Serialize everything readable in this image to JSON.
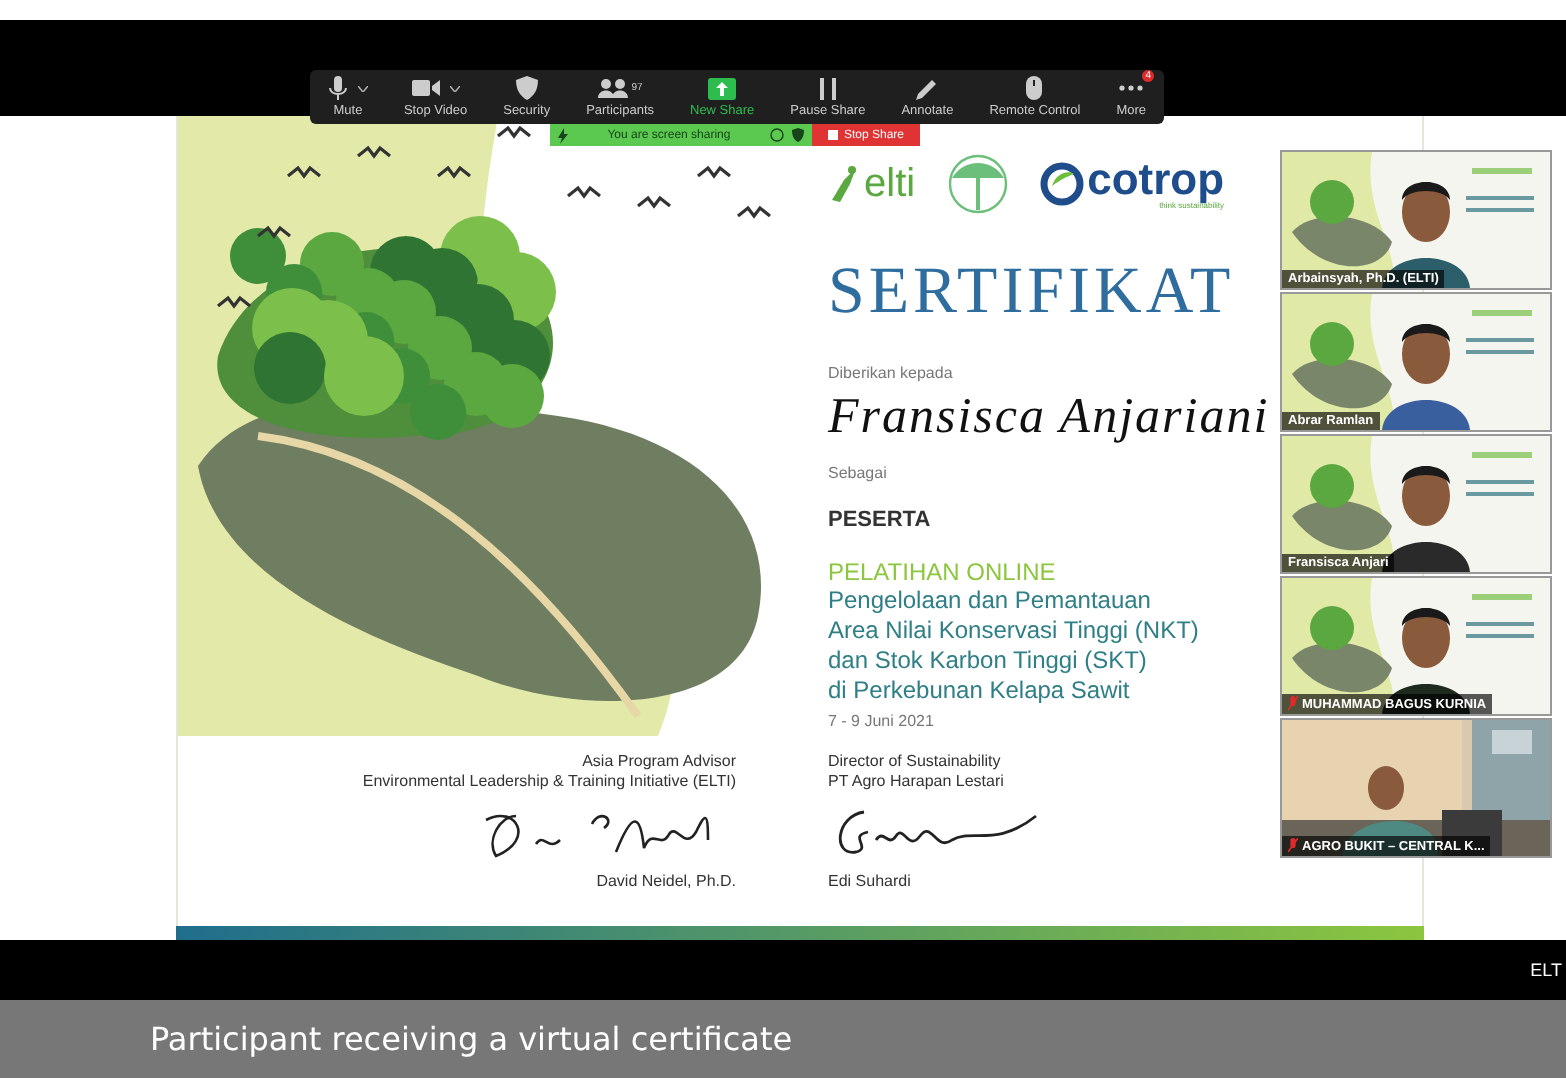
{
  "toolbar": {
    "items": [
      {
        "kind": "mic",
        "label": "Mute",
        "menu_caret": true,
        "highlighted": false
      },
      {
        "kind": "camera",
        "label": "Stop Video",
        "menu_caret": true,
        "highlighted": false
      },
      {
        "kind": "shield",
        "label": "Security",
        "menu_caret": false,
        "highlighted": false
      },
      {
        "kind": "people",
        "label": "Participants",
        "count": "97",
        "menu_caret": false,
        "highlighted": false
      },
      {
        "kind": "share",
        "label": "New Share",
        "menu_caret": false,
        "highlighted": true
      },
      {
        "kind": "pause",
        "label": "Pause Share",
        "menu_caret": false,
        "highlighted": false
      },
      {
        "kind": "pen",
        "label": "Annotate",
        "menu_caret": false,
        "highlighted": false
      },
      {
        "kind": "mouse",
        "label": "Remote Control",
        "menu_caret": false,
        "highlighted": false
      },
      {
        "kind": "dots",
        "label": "More",
        "badge": "4",
        "menu_caret": false,
        "highlighted": false
      }
    ]
  },
  "share_banner": {
    "status": "You are screen sharing",
    "stop_label": "Stop Share"
  },
  "certificate": {
    "logos": {
      "elti": "elti",
      "ecotrop": "cotrop",
      "ecotrop_tagline": "think sustainability"
    },
    "title": "SERTIFIKAT",
    "given_to": "Diberikan kepada",
    "recipient": "Fransisca Anjariani",
    "as_label": "Sebagai",
    "role": "PESERTA",
    "program": "PELATIHAN ONLINE",
    "course_lines": [
      "Pengelolaan dan Pemantauan",
      "Area Nilai Konservasi Tinggi (NKT)",
      "dan Stok Karbon Tinggi (SKT)",
      "di Perkebunan Kelapa Sawit"
    ],
    "date": "7 - 9 Juni 2021",
    "signatories": [
      {
        "titles": [
          "Asia Program Advisor",
          "Environmental Leadership & Training Initiative (ELTI)"
        ],
        "name": "David Neidel, Ph.D."
      },
      {
        "titles": [
          "Director of Sustainability",
          "PT Agro Harapan Lestari"
        ],
        "name": "Edi Suhardi"
      }
    ]
  },
  "participants": [
    {
      "name": "Arbainsyah, Ph.D. (ELTI)",
      "muted": false,
      "kind": "slide"
    },
    {
      "name": "Abrar Ramlan",
      "muted": false,
      "kind": "slide"
    },
    {
      "name": "Fransisca Anjari",
      "muted": false,
      "kind": "slide"
    },
    {
      "name": "MUHAMMAD BAGUS KURNIA",
      "muted": true,
      "kind": "slide"
    },
    {
      "name": "AGRO BUKIT – CENTRAL K...",
      "muted": true,
      "kind": "room"
    }
  ],
  "corner_label": "ELT",
  "caption": "Participant receiving a virtual certificate"
}
